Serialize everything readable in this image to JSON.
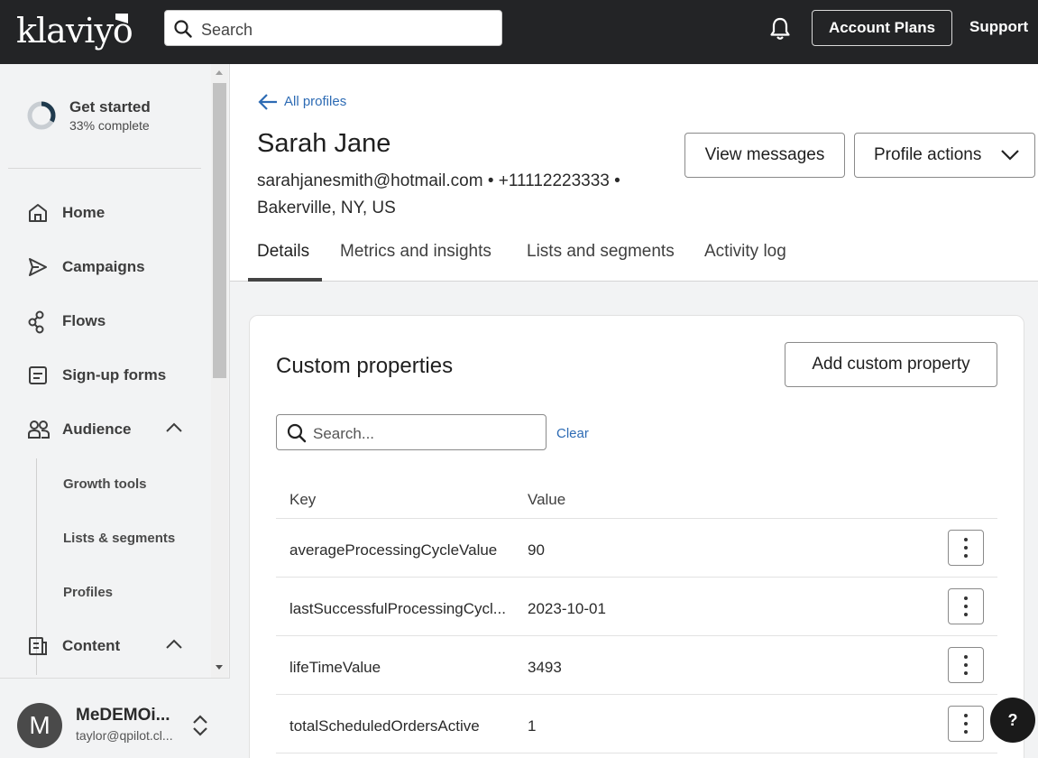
{
  "topbar": {
    "logo": "klaviyo",
    "search_placeholder": "Search",
    "account_plans_label": "Account Plans",
    "support_label": "Support"
  },
  "sidebar": {
    "get_started": {
      "title": "Get started",
      "progress_text": "33% complete",
      "progress": 0.33
    },
    "nav": {
      "home": "Home",
      "campaigns": "Campaigns",
      "flows": "Flows",
      "signup_forms": "Sign-up forms",
      "audience": "Audience",
      "content": "Content"
    },
    "audience_sub": {
      "growth_tools": "Growth tools",
      "lists_segments": "Lists & segments",
      "profiles": "Profiles"
    },
    "account": {
      "avatar_initial": "M",
      "name": "MeDEMOi...",
      "email": "taylor@qpilot.cl..."
    }
  },
  "profile": {
    "back_label": "All profiles",
    "name": "Sarah Jane",
    "meta_line1": "sarahjanesmith@hotmail.com • +11112223333 •",
    "meta_line2": "Bakerville, NY, US",
    "view_messages_label": "View messages",
    "profile_actions_label": "Profile actions"
  },
  "tabs": {
    "details": "Details",
    "metrics": "Metrics and insights",
    "lists": "Lists and segments",
    "activity": "Activity log"
  },
  "custom_properties": {
    "title": "Custom properties",
    "add_label": "Add custom property",
    "search_placeholder": "Search...",
    "clear_label": "Clear",
    "columns": {
      "key": "Key",
      "value": "Value"
    },
    "rows": [
      {
        "key": "averageProcessingCycleValue",
        "value": "90"
      },
      {
        "key": "lastSuccessfulProcessingCycl...",
        "value": "2023-10-01"
      },
      {
        "key": "lifeTimeValue",
        "value": "3493"
      },
      {
        "key": "totalScheduledOrdersActive",
        "value": "1"
      }
    ]
  },
  "help_label": "?",
  "colors": {
    "topbar": "#232426",
    "link": "#2d6bb4",
    "sidebar": "#f2f3f4"
  }
}
